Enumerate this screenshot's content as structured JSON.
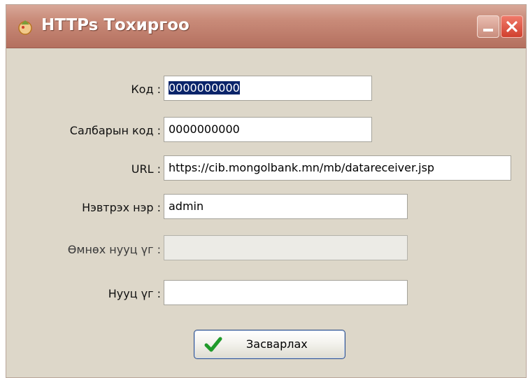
{
  "window": {
    "title": "HTTPs Тохиргоо"
  },
  "form": {
    "code": {
      "label": "Код :",
      "value": "0000000000"
    },
    "branch_code": {
      "label": "Салбарын код :",
      "value": "0000000000"
    },
    "url": {
      "label": "URL :",
      "value": "https://cib.mongolbank.mn/mb/datareceiver.jsp"
    },
    "username": {
      "label": "Нэвтрэх нэр :",
      "value": "admin"
    },
    "old_password": {
      "label": "Өмнөх нууц үг :",
      "value": ""
    },
    "password": {
      "label": "Нууц үг :",
      "value": ""
    }
  },
  "actions": {
    "edit_label": "Засварлах"
  },
  "icons": {
    "app": "app-icon",
    "minimize": "minimize-icon",
    "close": "close-icon",
    "check": "check-icon"
  },
  "colors": {
    "titlebar": "#c98b79",
    "window_bg": "#ddd7c9",
    "close_button": "#d0402e",
    "selection": "#0a246a",
    "check": "#1f9a2a"
  }
}
